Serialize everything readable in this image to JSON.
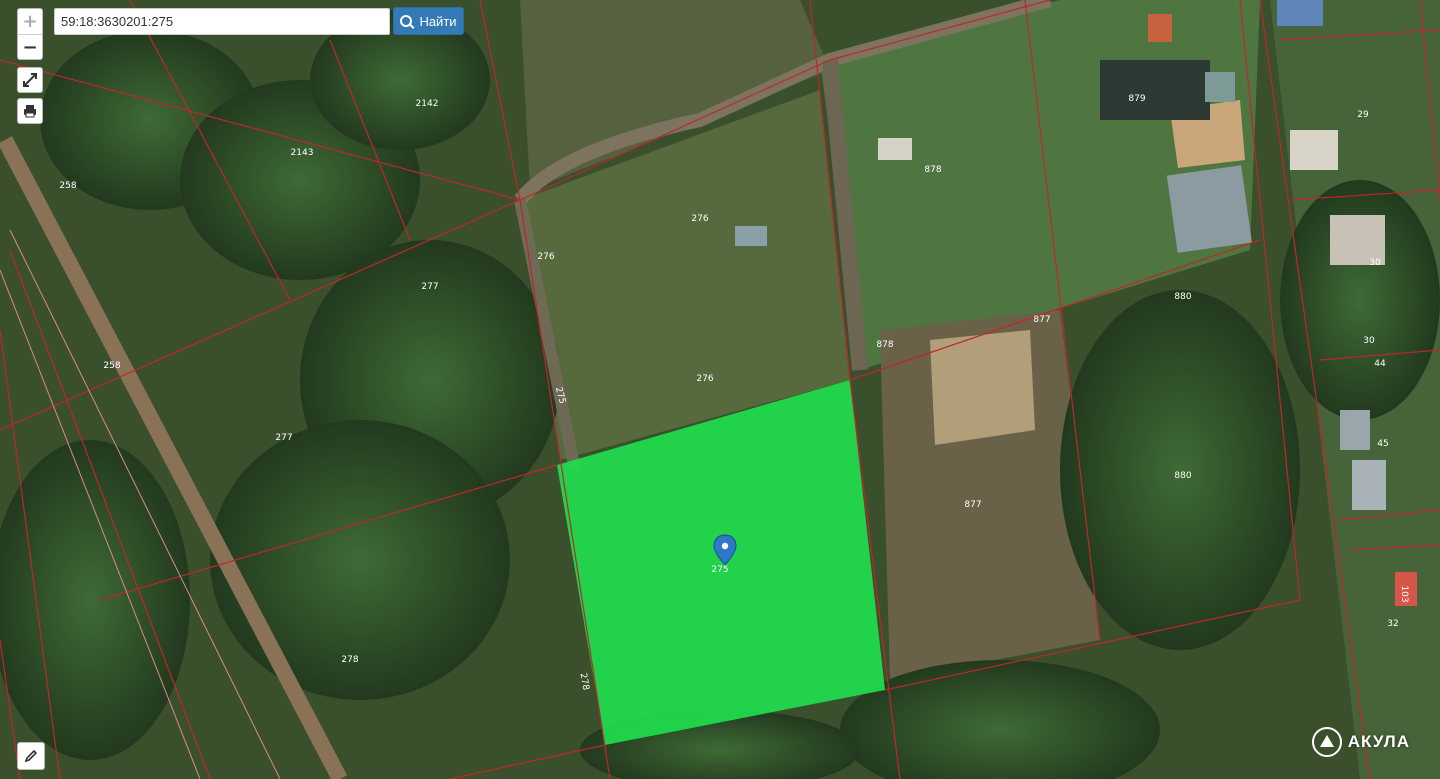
{
  "search": {
    "value": "59:18:3630201:275",
    "button_label": "Найти"
  },
  "logo": {
    "text": "АКУЛА"
  },
  "colors": {
    "highlight": "#1fdd4d",
    "boundary": "#c0262a",
    "pin": "#2f78c8"
  },
  "parcel_labels": [
    "2142",
    "2143",
    "258",
    "277",
    "276",
    "276",
    "276",
    "275",
    "275",
    "278",
    "278",
    "277",
    "258",
    "878",
    "878",
    "877",
    "877",
    "879",
    "880",
    "880",
    "29",
    "30",
    "30",
    "44",
    "45",
    "103",
    "32"
  ]
}
